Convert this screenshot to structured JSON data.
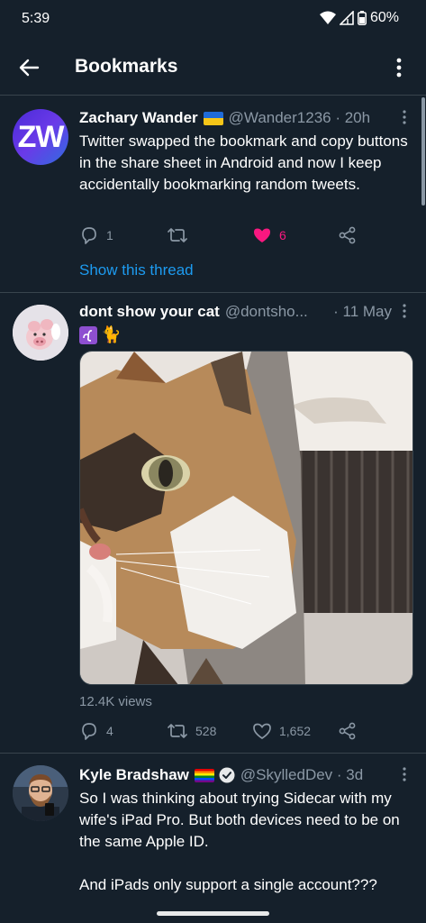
{
  "status": {
    "time": "5:39",
    "battery": "60%"
  },
  "header": {
    "title": "Bookmarks"
  },
  "tweets": [
    {
      "avatar_initials": "ZW",
      "name": "Zachary Wander",
      "handle": "@Wander1236 · 20h",
      "text": "Twitter swapped the bookmark and copy buttons in the share sheet in Android and now I keep accidentally bookmarking random tweets.",
      "replies": "1",
      "likes": "6",
      "show_thread": "Show this thread"
    },
    {
      "name": "dont show your cat",
      "handle": "@dontsho...",
      "time": "· 11 May",
      "text": "🐈",
      "views": "12.4K views",
      "replies": "4",
      "retweets": "528",
      "likes": "1,652"
    },
    {
      "name": "Kyle Bradshaw",
      "handle": "@SkylledDev · 3d",
      "text": "So I was thinking about trying Sidecar with my wife's iPad Pro. But both devices need to be on the same Apple ID.",
      "text2": "And iPads only support a single account???"
    }
  ],
  "colors": {
    "background": "#15202b",
    "accent": "#1d9bf0",
    "like": "#f91880",
    "muted": "#8b98a5"
  }
}
